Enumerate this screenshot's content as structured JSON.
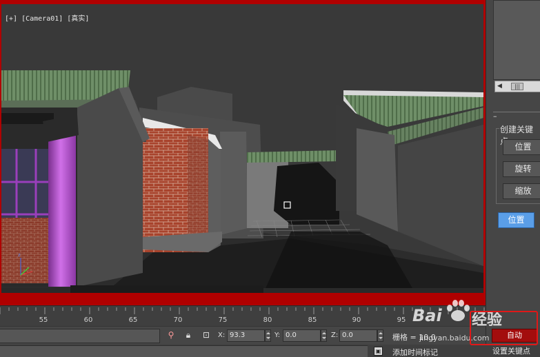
{
  "viewport": {
    "label": "[+] [Camera01] [真实]",
    "colors": {
      "frame": "#b00000",
      "background": "#393939"
    }
  },
  "command_panel": {
    "rollout_toggle": "–",
    "group_title": "创建关键点",
    "buttons": [
      {
        "label": "位置"
      },
      {
        "label": "旋转"
      },
      {
        "label": "缩放"
      }
    ],
    "active_button": {
      "label": "位置"
    }
  },
  "timeline": {
    "ticks": [
      "55",
      "60",
      "65",
      "70",
      "75",
      "80",
      "85",
      "90",
      "95"
    ]
  },
  "status": {
    "x_label": "X:",
    "x_value": "93.3",
    "y_label": "Y:",
    "y_value": "0.0",
    "z_label": "Z:",
    "z_value": "0.0",
    "grid": "栅格 = 10.0",
    "add_time_tag": "添加时间标记"
  },
  "animation": {
    "auto_key": "自动",
    "set_key": "设置关键点",
    "colors": {
      "auto_key": "#a30d0d",
      "highlight": "#e11818"
    }
  },
  "watermark": {
    "brand_left": "Bai",
    "brand_right": "经验",
    "url": "jingyan.baidu.com"
  }
}
